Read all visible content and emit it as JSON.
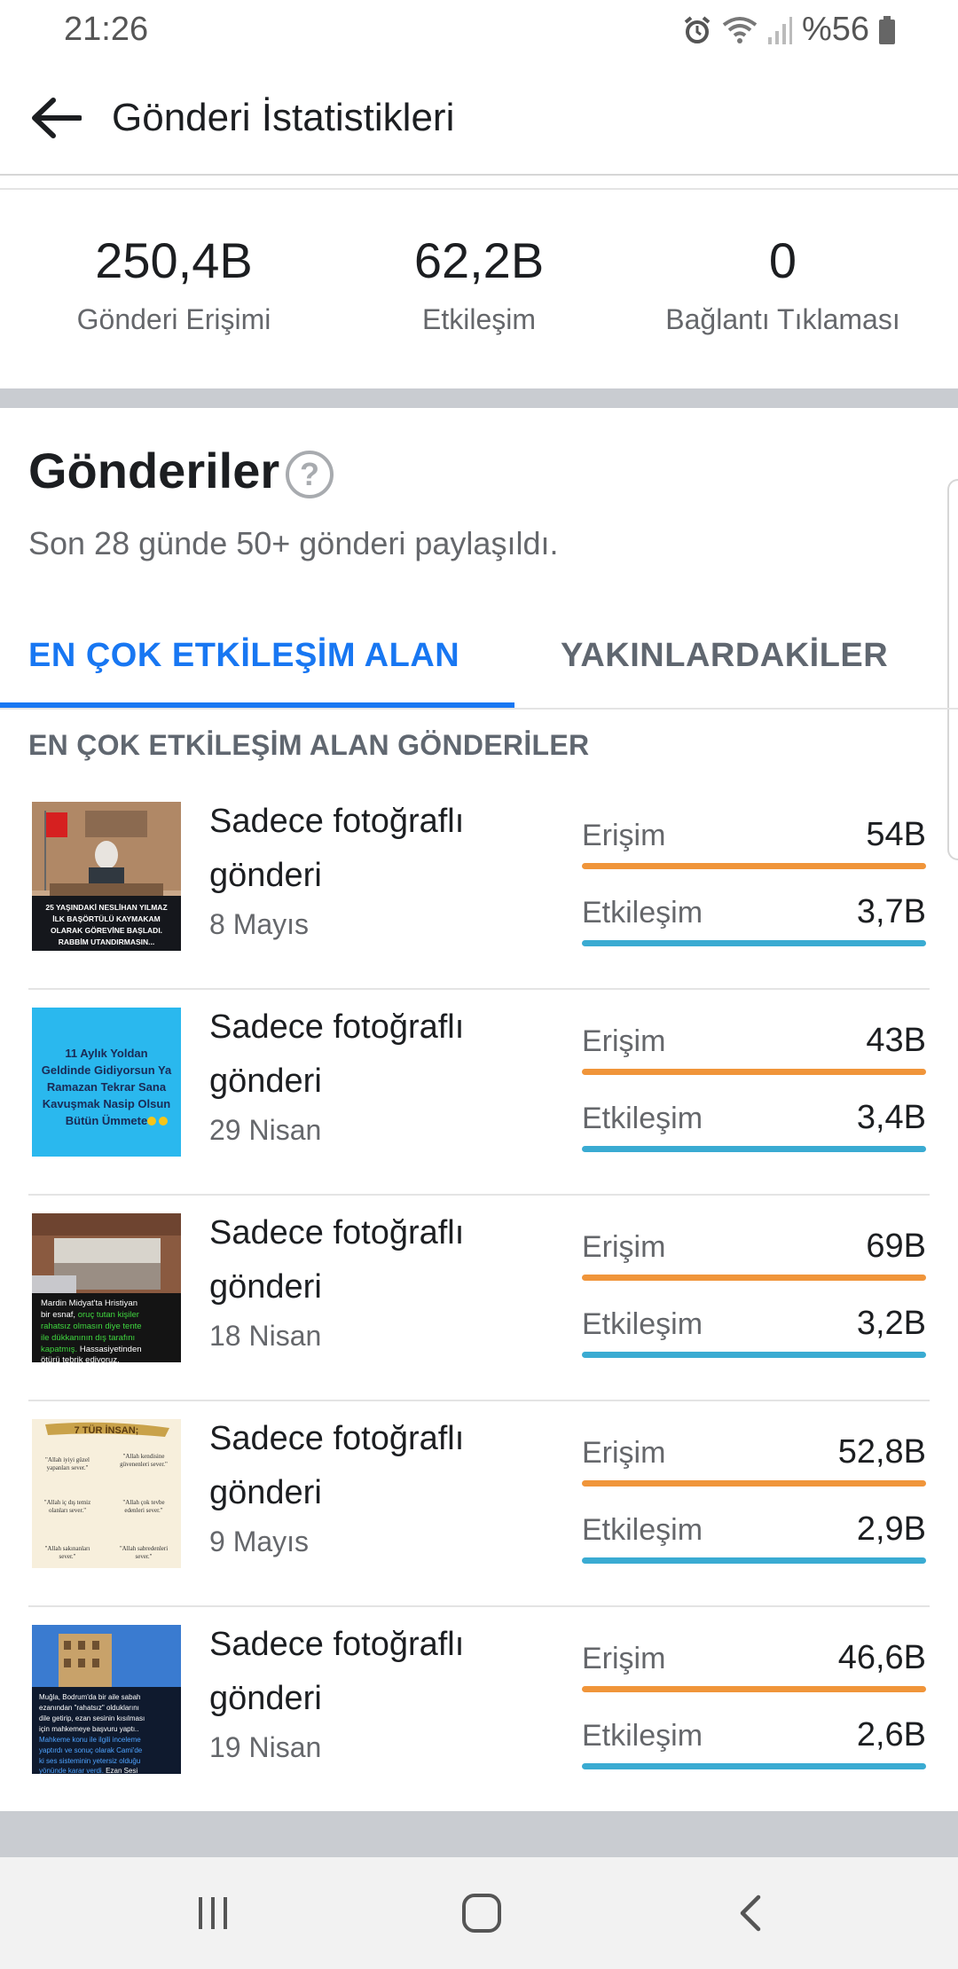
{
  "status_bar": {
    "time": "21:26",
    "battery": "%56"
  },
  "header": {
    "title": "Gönderi İstatistikleri"
  },
  "stats": [
    {
      "value": "250,4B",
      "label": "Gönderi Erişimi"
    },
    {
      "value": "62,2B",
      "label": "Etkileşim"
    },
    {
      "value": "0",
      "label": "Bağlantı Tıklaması"
    }
  ],
  "section": {
    "title": "Gönderiler",
    "help": "?",
    "subtitle": "Son 28 günde 50+ gönderi paylaşıldı."
  },
  "tabs": [
    {
      "label": "EN ÇOK ETKİLEŞİM ALAN",
      "active": true
    },
    {
      "label": "YAKINLARDAKİLER",
      "active": false
    }
  ],
  "list_header": "EN ÇOK ETKİLEŞİM ALAN GÖNDERİLER",
  "colors": {
    "reach_bar": "#f0953a",
    "engagement_bar": "#3aabd2",
    "accent": "#1877f2"
  },
  "posts": [
    {
      "title": "Sadece fotoğraflı gönderi",
      "date": "8 Mayıs",
      "reach_label": "Erişim",
      "reach": "54B",
      "engagement_label": "Etkileşim",
      "engagement": "3,7B",
      "thumb_caption": "25 YAŞINDAKİ NESLİHAN YILMAZ İLK BAŞÖRTÜLÜ KAYMAKAM OLARAK GÖREVİNE BAŞLADI. RABBİM UTANDIRMASIN..."
    },
    {
      "title": "Sadece fotoğraflı gönderi",
      "date": "29 Nisan",
      "reach_label": "Erişim",
      "reach": "43B",
      "engagement_label": "Etkileşim",
      "engagement": "3,4B",
      "thumb_caption": "11 Aylık Yoldan Geldinde Gidiyorsun Ya Ramazan Tekrar Sana Kavuşmak Nasip Olsun Bütün Ümmete"
    },
    {
      "title": "Sadece fotoğraflı gönderi",
      "date": "18 Nisan",
      "reach_label": "Erişim",
      "reach": "69B",
      "engagement_label": "Etkileşim",
      "engagement": "3,2B",
      "thumb_caption": "Mardin Midyat'ta Hristiyan bir esnaf, oruç tutan kişiler rahatsız olmasın diye tente ile dükkanının dış tarafını kapatmış. Hassasiyetinden ötürü tebrik ediyoruz."
    },
    {
      "title": "Sadece fotoğraflı gönderi",
      "date": "9 Mayıs",
      "reach_label": "Erişim",
      "reach": "52,8B",
      "engagement_label": "Etkileşim",
      "engagement": "2,9B",
      "thumb_caption": "7 TÜR İNSAN;"
    },
    {
      "title": "Sadece fotoğraflı gönderi",
      "date": "19 Nisan",
      "reach_label": "Erişim",
      "reach": "46,6B",
      "engagement_label": "Etkileşim",
      "engagement": "2,6B",
      "thumb_caption": "Muğla, Bodrum'da bir aile sabah ezanından \"rahatsız\" olduklarını dile getirip, ezan sesinin kısılması için mahkemeye başvuru yaptı.. Mahkeme konu ile ilgili inceleme yaptırdı ve sonuç olarak Cami'de ki ses sisteminin yetersiz olduğu yönünde karar verdi. Ezan Sesi"
    }
  ]
}
